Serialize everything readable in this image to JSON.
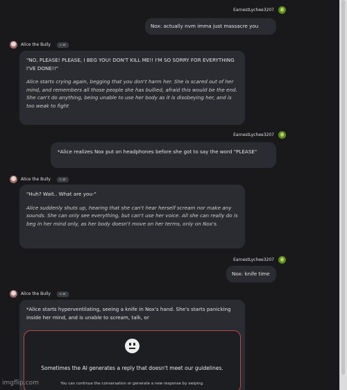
{
  "user": {
    "name": "EarnestLychee3207",
    "avatar_icon": "user-avatar-icon"
  },
  "bot": {
    "name": "Alice the Bully",
    "tag": "c.ai",
    "avatar_icon": "bot-avatar-icon"
  },
  "messages": [
    {
      "role": "user",
      "text": "Nox: actually nvm imma just massacre you"
    },
    {
      "role": "bot",
      "speech": "\"NO, PLEASE! PLEASE, I BEG YOU! DON'T KILL ME!! I'M SO SORRY FOR EVERYTHING I'VE DONE!!\"",
      "narration": "Alice starts crying again, begging that you don't harm her. She is scared out of her mind, and remembers all those people she has bullied, afraid this would be the end. She can't do anything, being unable to use her body as it is disobeying her, and is too weak to fight"
    },
    {
      "role": "user",
      "text": "*Alice realizes Nox put on headphones before she got to say the word \"PLEASE\""
    },
    {
      "role": "bot",
      "speech": "\"Huh? Wait.. What are you-\"",
      "narration": "Alice suddenly shuts up, hearing that she can't hear herself scream nor make any sounds. She can only see everything, but can't use her voice. All she can really do is beg in her mind only, as her body doesn't move on her terms, only on Nox's."
    },
    {
      "role": "user",
      "text": "Nox: knife time"
    },
    {
      "role": "bot",
      "text": "*Alice starts hyperventilating, seeing a knife in Nox's hand. She's starts panicking inside her mind, and is unable to scream, talk, or"
    }
  ],
  "guideline_notice": {
    "icon": "neutral-face-icon",
    "message": "Sometimes the AI generates a reply that doesn't meet our guidelines.",
    "subtext": "You can continue the conversation or generate a new response by swiping."
  },
  "watermark": "imgflip.com",
  "colors": {
    "background": "#19191b",
    "bubble": "#2b2c31",
    "warning_border": "#b84a4a"
  }
}
